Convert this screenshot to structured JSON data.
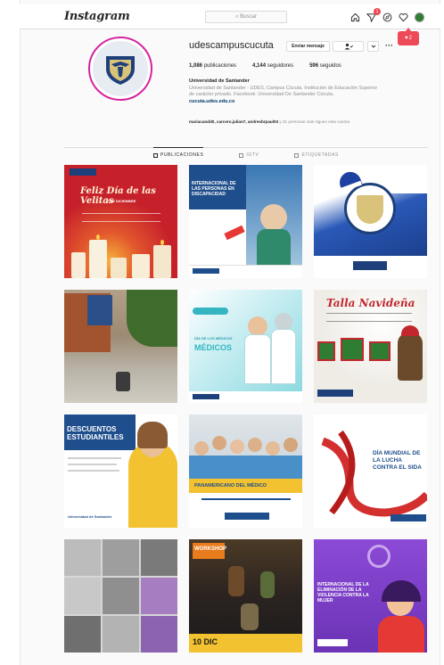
{
  "nav": {
    "logo": "Instagram",
    "search_placeholder": "Buscar",
    "dm_badge": "1",
    "notif_count": "2",
    "icons": [
      "home-icon",
      "direct-icon",
      "explore-icon",
      "heart-icon",
      "profile-avatar"
    ]
  },
  "profile": {
    "username": "udescampuscucuta",
    "send_message": "Enviar mensaje",
    "posts_count": "1,086",
    "posts_label": "publicaciones",
    "followers_count": "4,144",
    "followers_label": "seguidores",
    "following_count": "596",
    "following_label": "seguidos",
    "name": "Universidad de Santander",
    "bio_line1": "Universidad de Santander - UDES, Campus Cúcuta. Institución de Educación Superior",
    "bio_line2": "de carácter privado. Facebook: Universidad De Santander Cúcuta.",
    "link": "cucuta.udes.edu.co",
    "followed_by_names": "mariacandd0, carcero.julian7, andresbrpaul03",
    "followed_by_rest": "y 31 personas más siguen esta cuenta"
  },
  "tabs": [
    {
      "label": "PUBLICACIONES",
      "icon": "grid-icon"
    },
    {
      "label": "IGTV",
      "icon": "igtv-icon"
    },
    {
      "label": "ETIQUETADAS",
      "icon": "tag-icon"
    }
  ],
  "posts": {
    "p1": {
      "title": "Feliz Día de las Velitas",
      "sub": "7 DE DICIEMBRE"
    },
    "p2": {
      "title": "INTERNACIONAL DE LAS PERSONAS EN DISCAPACIDAD"
    },
    "p3": {},
    "p4": {},
    "p5": {
      "title": "MÉDICOS",
      "kicker": "DÍA DE LOS MÉDICOS"
    },
    "p6": {
      "title": "Talla Navideña"
    },
    "p7": {
      "title": "DESCUENTOS ESTUDIANTILES",
      "brand": "Universidad de Santander"
    },
    "p8": {
      "title": "PANAMERICANO DEL MÉDICO"
    },
    "p9": {
      "title": "DÍA MUNDIAL DE LA LUCHA CONTRA EL SIDA"
    },
    "p10": {},
    "p11": {
      "title": "WORKSHOP",
      "date": "10 DIC"
    },
    "p12": {
      "title": "INTERNACIONAL DE LA ELIMINACIÓN DE LA VIOLENCIA CONTRA LA MUJER"
    }
  }
}
